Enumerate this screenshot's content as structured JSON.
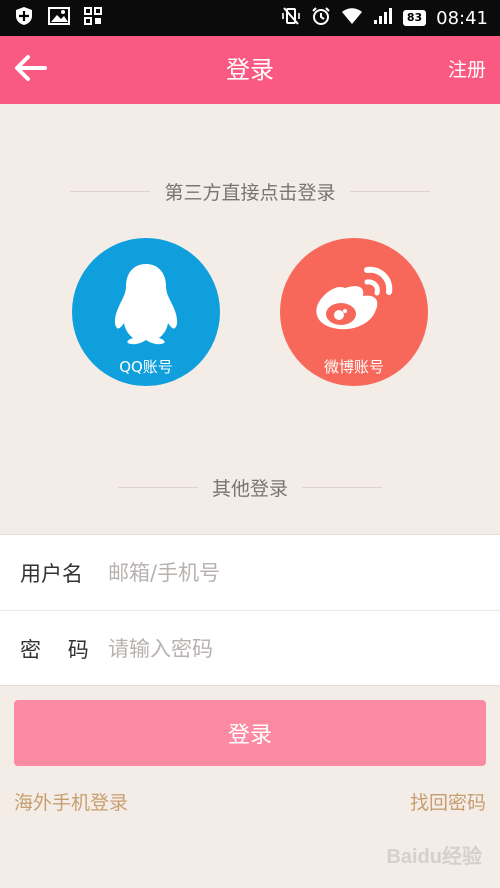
{
  "status_bar": {
    "battery": "83",
    "time": "08:41"
  },
  "header": {
    "title": "登录",
    "register_label": "注册"
  },
  "third_party": {
    "title": "第三方直接点击登录",
    "qq_label": "QQ账号",
    "weibo_label": "微博账号"
  },
  "other_login": {
    "title": "其他登录"
  },
  "form": {
    "username_label": "用户名",
    "username_placeholder": "邮箱/手机号",
    "password_label": "密    码",
    "password_placeholder": "请输入密码"
  },
  "actions": {
    "login_label": "登录",
    "overseas_label": "海外手机登录",
    "forgot_label": "找回密码"
  },
  "watermark": "Baidu经验",
  "colors": {
    "header": "#fa5a82",
    "qq": "#109fdd",
    "weibo": "#f7685a",
    "login_button": "#fc8aa2",
    "link": "#c79f6f"
  }
}
